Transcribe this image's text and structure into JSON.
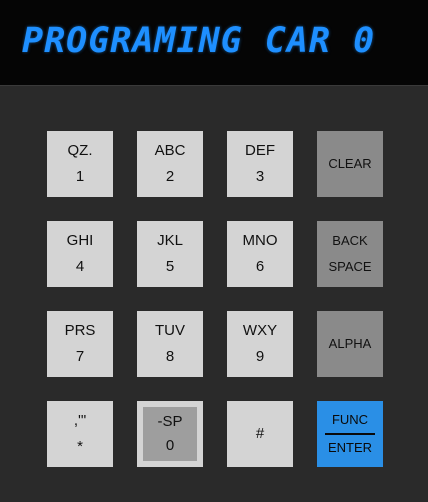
{
  "display": {
    "text": "PROGRAMING CAR 0"
  },
  "keys": [
    {
      "top": "QZ.",
      "bottom": "1"
    },
    {
      "top": "ABC",
      "bottom": "2"
    },
    {
      "top": "DEF",
      "bottom": "3"
    },
    {
      "top": "CLEAR"
    },
    {
      "top": "GHI",
      "bottom": "4"
    },
    {
      "top": "JKL",
      "bottom": "5"
    },
    {
      "top": "MNO",
      "bottom": "6"
    },
    {
      "top": "BACK",
      "bottom": "SPACE"
    },
    {
      "top": "PRS",
      "bottom": "7"
    },
    {
      "top": "TUV",
      "bottom": "8"
    },
    {
      "top": "WXY",
      "bottom": "9"
    },
    {
      "top": "ALPHA"
    },
    {
      "top": ",'\"",
      "bottom": "*"
    },
    {
      "top": "-SP",
      "bottom": "0"
    },
    {
      "top": "#"
    },
    {
      "top": "FUNC",
      "bottom": "ENTER"
    }
  ],
  "colors": {
    "display_text": "#1e8fff",
    "key_light": "#d4d4d4",
    "key_dark": "#8a8a8a",
    "key_func": "#2a8fe6"
  }
}
